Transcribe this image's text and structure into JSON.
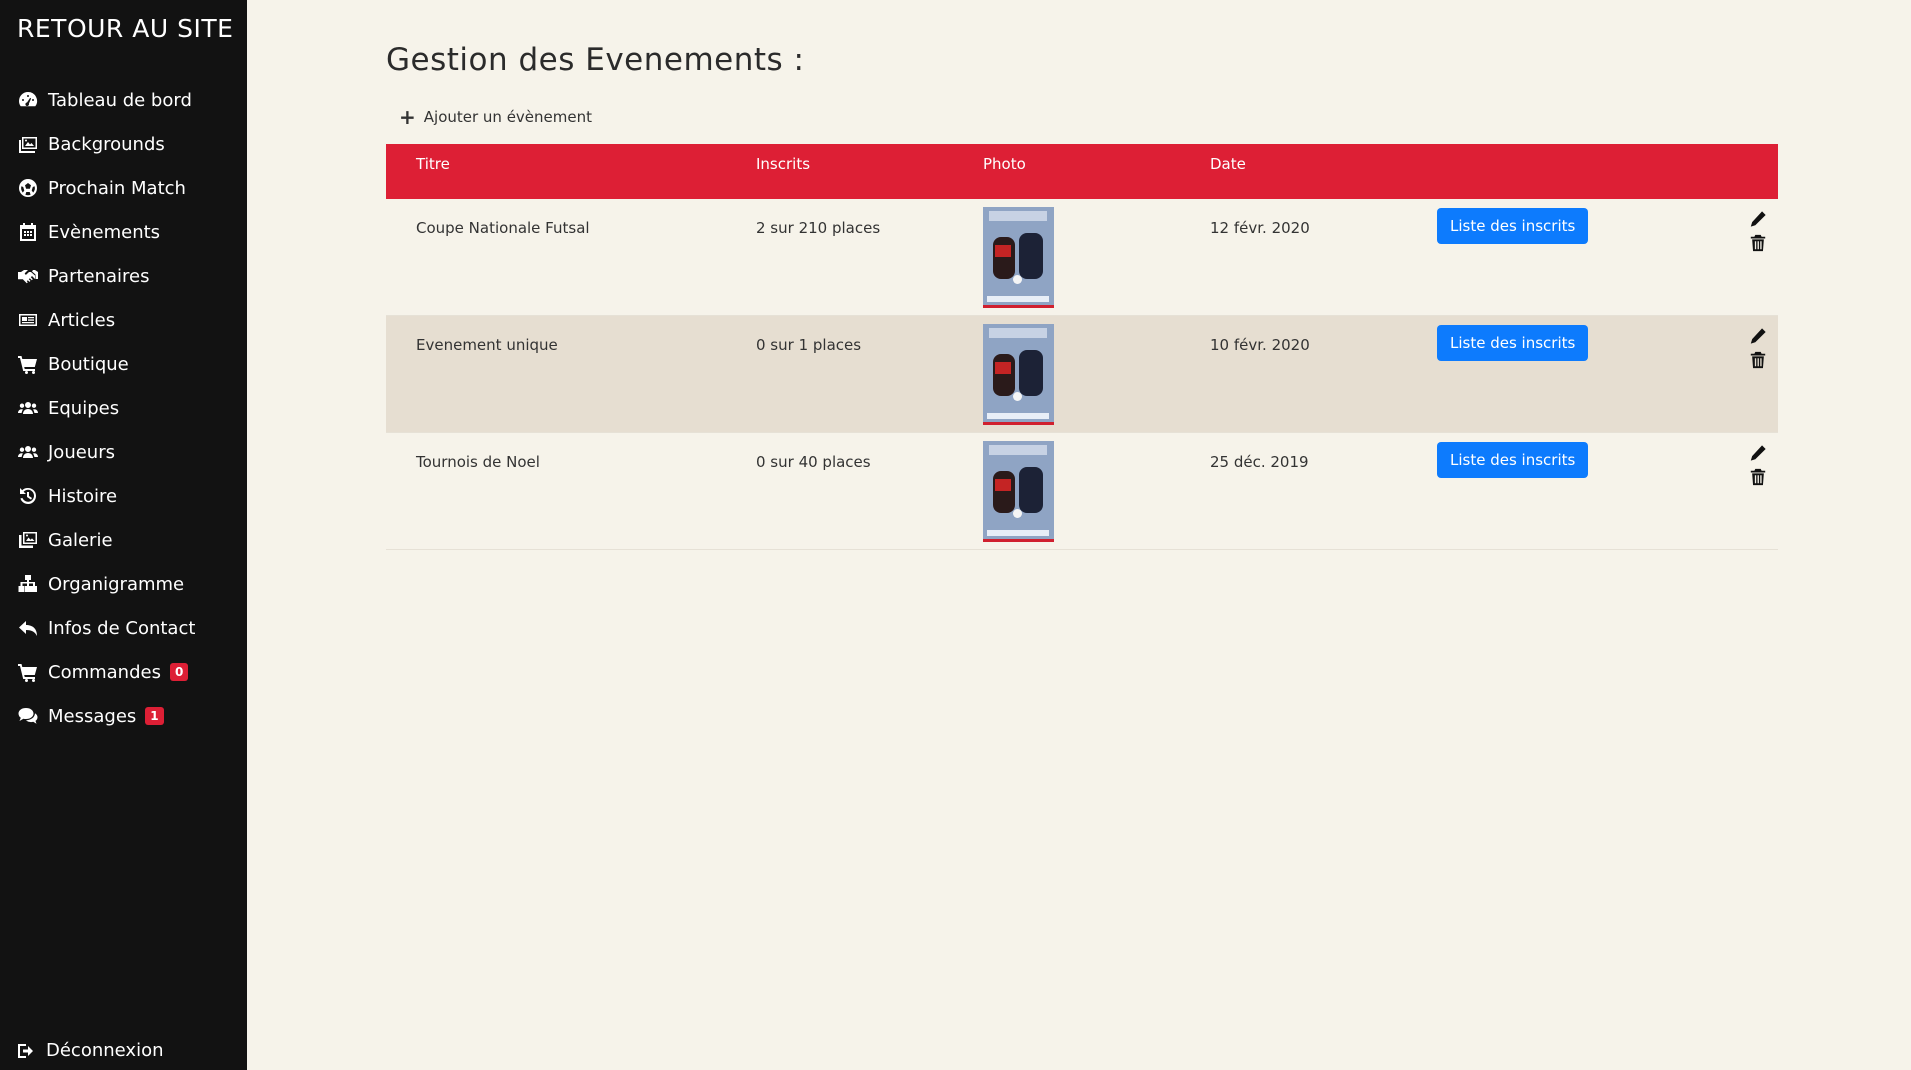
{
  "sidebar": {
    "brand": "RETOUR AU SITE",
    "items": [
      {
        "label": "Tableau de bord",
        "icon": "gauge-icon"
      },
      {
        "label": "Backgrounds",
        "icon": "images-icon"
      },
      {
        "label": "Prochain Match",
        "icon": "soccer-ball-icon"
      },
      {
        "label": "Evènements",
        "icon": "calendar-icon"
      },
      {
        "label": "Partenaires",
        "icon": "handshake-icon"
      },
      {
        "label": "Articles",
        "icon": "newspaper-icon"
      },
      {
        "label": "Boutique",
        "icon": "cart-icon"
      },
      {
        "label": "Equipes",
        "icon": "users-icon"
      },
      {
        "label": "Joueurs",
        "icon": "users-icon"
      },
      {
        "label": "Histoire",
        "icon": "history-icon"
      },
      {
        "label": "Galerie",
        "icon": "gallery-icon"
      },
      {
        "label": "Organigramme",
        "icon": "sitemap-icon"
      },
      {
        "label": "Infos de Contact",
        "icon": "reply-icon"
      },
      {
        "label": "Commandes",
        "icon": "cart-icon",
        "badge": "0"
      },
      {
        "label": "Messages",
        "icon": "comments-icon",
        "badge": "1"
      }
    ],
    "logout": "Déconnexion"
  },
  "main": {
    "title": "Gestion des Evenements :",
    "add_label": "Ajouter un évènement",
    "columns": [
      "Titre",
      "Inscrits",
      "Photo",
      "Date"
    ],
    "rows": [
      {
        "title": "Coupe Nationale Futsal",
        "inscrits": "2 sur 210 places",
        "date": "12 févr. 2020",
        "button": "Liste des inscrits"
      },
      {
        "title": "Evenement unique",
        "inscrits": "0 sur 1 places",
        "date": "10 févr. 2020",
        "button": "Liste des inscrits"
      },
      {
        "title": "Tournois de Noel",
        "inscrits": "0 sur 40 places",
        "date": "25 déc. 2019",
        "button": "Liste des inscrits"
      }
    ]
  },
  "colors": {
    "sidebar_bg": "#121212",
    "page_bg": "#f6f3ea",
    "accent_red": "#dd1f35",
    "button_blue": "#0d7bfd",
    "alt_row": "#e6ded1"
  }
}
